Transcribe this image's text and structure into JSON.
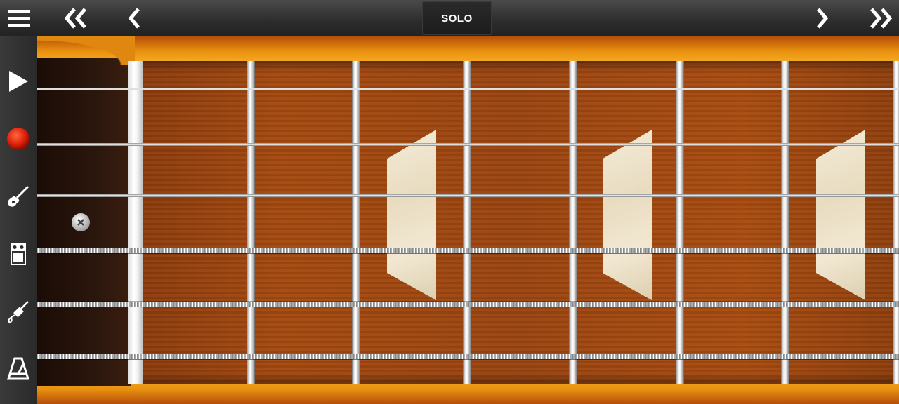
{
  "toolbar": {
    "mode_label": "SOLO",
    "icons": [
      "menu-icon",
      "double-chevron-left-icon",
      "chevron-left-icon",
      "chevron-right-icon",
      "double-chevron-right-icon"
    ]
  },
  "sidebar": {
    "items": [
      {
        "name": "play-icon"
      },
      {
        "name": "record-icon"
      },
      {
        "name": "guitar-icon"
      },
      {
        "name": "amplifier-icon"
      },
      {
        "name": "cable-jack-icon"
      },
      {
        "name": "metronome-icon"
      }
    ]
  },
  "colors": {
    "record": "#e0220c",
    "wood": "#a4490f",
    "binding": "#f6b52b"
  }
}
